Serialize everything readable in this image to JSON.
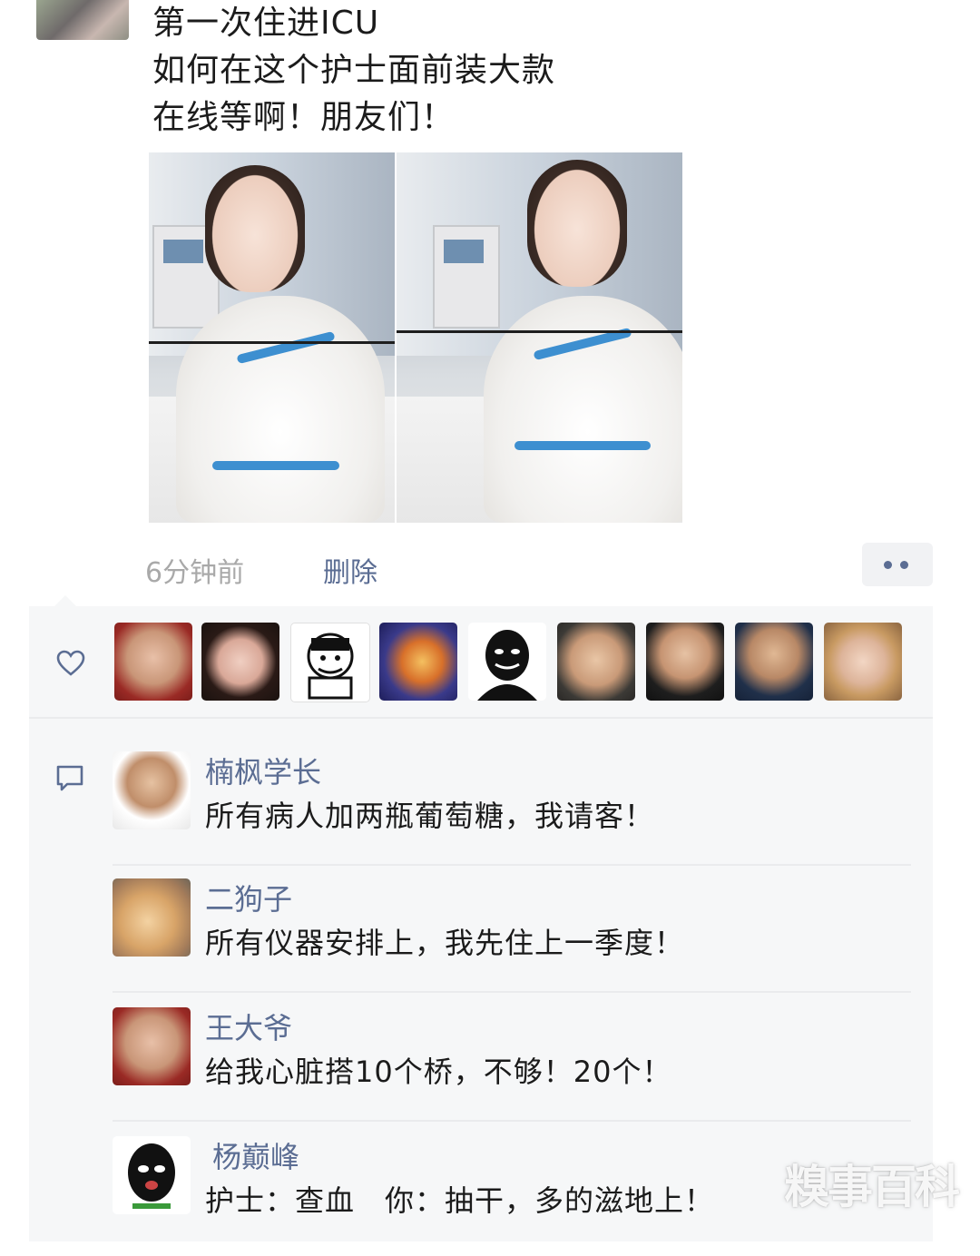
{
  "post": {
    "lines": [
      "第一次住进ICU",
      "如何在这个护士面前装大款",
      "在线等啊！朋友们！"
    ],
    "time": "6分钟前",
    "delete_label": "删除",
    "more_icon": "more-dots-icon"
  },
  "likes": {
    "icon": "heart-icon",
    "avatars": [
      "avatar-1",
      "avatar-2",
      "avatar-3",
      "avatar-4",
      "avatar-5",
      "avatar-6",
      "avatar-7",
      "avatar-8",
      "avatar-9"
    ]
  },
  "comments": [
    {
      "name": "楠枫学长",
      "text": "所有病人加两瓶葡萄糖，我请客！"
    },
    {
      "name": "二狗子",
      "text": "所有仪器安排上，我先住上一季度！"
    },
    {
      "name": "王大爷",
      "text": "给我心脏搭10个桥，不够！20个！"
    },
    {
      "name": "杨巅峰",
      "text": "护士：查血　你：抽干，多的滋地上！"
    }
  ],
  "watermark": "糗事百科",
  "colors": {
    "link": "#5b6d93",
    "meta": "#a9a9a9",
    "panel": "#f6f7f8"
  }
}
